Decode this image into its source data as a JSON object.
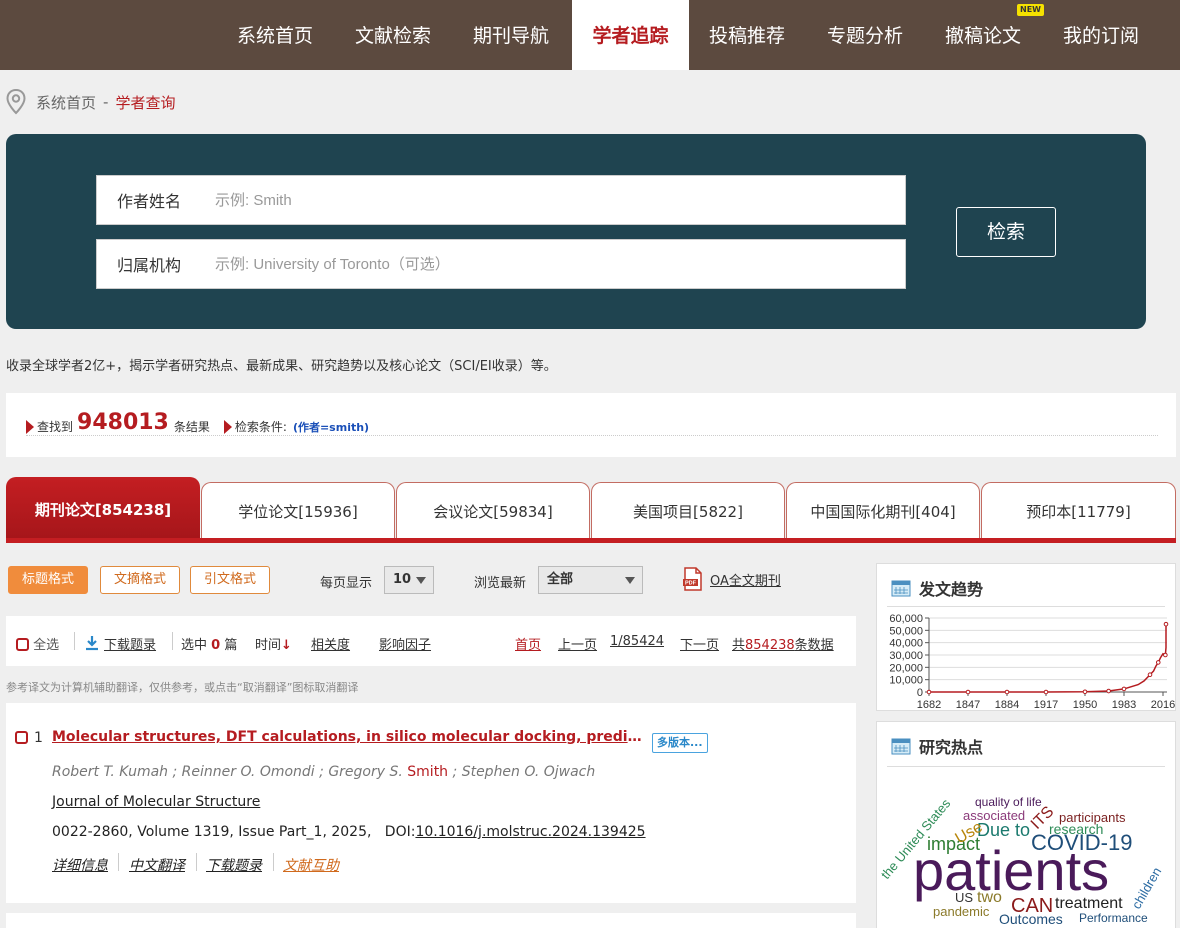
{
  "nav": [
    {
      "label": "系统首页",
      "active": false
    },
    {
      "label": "文献检索",
      "active": false
    },
    {
      "label": "期刊导航",
      "active": false
    },
    {
      "label": "学者追踪",
      "active": true
    },
    {
      "label": "投稿推荐",
      "active": false
    },
    {
      "label": "专题分析",
      "active": false
    },
    {
      "label": "撤稿论文",
      "active": false,
      "badge": "NEW"
    },
    {
      "label": "我的订阅",
      "active": false
    }
  ],
  "breadcrumb": {
    "home": "系统首页",
    "sep": "-",
    "current": "学者查询"
  },
  "search": {
    "author_label": "作者姓名",
    "author_placeholder": "示例: Smith",
    "org_label": "归属机构",
    "org_placeholder": "示例: University of Toronto（可选）",
    "button": "检索"
  },
  "description": "收录全球学者2亿+，揭示学者研究热点、最新成果、研究趋势以及核心论文（SCI/EI收录）等。",
  "summary": {
    "found_prefix": "查找到",
    "count": "948013",
    "found_suffix": "条结果",
    "cond_label": "检索条件:",
    "cond_value": "(作者=smith)"
  },
  "tabs": [
    {
      "label": "期刊论文[854238]",
      "active": true
    },
    {
      "label": "学位论文[15936]"
    },
    {
      "label": "会议论文[59834]"
    },
    {
      "label": "美国项目[5822]"
    },
    {
      "label": "中国国际化期刊[404]"
    },
    {
      "label": "预印本[11779]"
    }
  ],
  "formats": [
    "标题格式",
    "文摘格式",
    "引文格式"
  ],
  "perpage": {
    "label": "每页显示",
    "value": "10"
  },
  "browse": {
    "label": "浏览最新",
    "value": "全部"
  },
  "oa_label": "OA全文期刊",
  "toolbar": {
    "select_all": "全选",
    "download": "下载题录",
    "selected_prefix": "选中",
    "selected_count": "0",
    "selected_suffix": "篇",
    "sort_time": "时间",
    "sort_relevance": "相关度",
    "sort_impact": "影响因子",
    "first": "首页",
    "prev": "上一页",
    "page": "1/85424",
    "next": "下一页",
    "total_prefix": "共",
    "total_count": "854238",
    "total_suffix": "条数据"
  },
  "note": "参考译文为计算机辅助翻译，仅供参考，或点击“取消翻译”图标取消翻译",
  "record": {
    "index": "1",
    "title": "Molecular structures, DFT calculations, in silico molecular docking, predicted pharmacokinetics",
    "versions": "多版本...",
    "authors": [
      {
        "name": "Robert T. Kumah",
        "highlight": false
      },
      {
        "name": "Reinner O. Omondi",
        "highlight": false
      },
      {
        "name": "Gregory S.",
        "suffix": "Smith",
        "highlight": true
      },
      {
        "name": "Stephen O. Ojwach",
        "highlight": false
      }
    ],
    "author_sep": " ; ",
    "journal": "Journal of Molecular Structure",
    "meta": "0022-2860, Volume 1319, Issue Part_1, 2025,   DOI:",
    "doi": "10.1016/j.molstruc.2024.139425",
    "actions": [
      "详细信息",
      "中文翻译",
      "下载题录",
      "文献互助"
    ]
  },
  "sidebar": {
    "trend_title": "发文趋势",
    "hot_title": "研究热点"
  },
  "chart_data": {
    "type": "line",
    "x_ticks": [
      "1682",
      "1847",
      "1884",
      "1917",
      "1950",
      "1983",
      "2016"
    ],
    "y_ticks": [
      "60,000",
      "50,000",
      "40,000",
      "30,000",
      "20,000",
      "10,000",
      "0"
    ],
    "ylim": [
      0,
      60000
    ],
    "x": [
      1682,
      1847,
      1884,
      1917,
      1950,
      1970,
      1983,
      1995,
      2000,
      2005,
      2008,
      2010,
      2012,
      2014,
      2016,
      2018,
      2020,
      2022,
      2023,
      2024
    ],
    "y": [
      0,
      0,
      0,
      0,
      200,
      800,
      2500,
      6000,
      9000,
      14000,
      17000,
      21000,
      24000,
      28000,
      31000,
      30000,
      36000,
      42000,
      55000,
      40000
    ],
    "line_color": "#b51c20"
  },
  "wordcloud": [
    {
      "text": "patients",
      "color": "#4a1a5a"
    },
    {
      "text": "COVID-19",
      "color": "#1f4e79"
    },
    {
      "text": "impact",
      "color": "#2e7d32"
    },
    {
      "text": "Due to",
      "color": "#1b7a6e"
    },
    {
      "text": "ITS",
      "color": "#8b1a1a"
    },
    {
      "text": "CAN",
      "color": "#8b1a1a"
    },
    {
      "text": "treatment",
      "color": "#222"
    },
    {
      "text": "research",
      "color": "#2e8b57"
    },
    {
      "text": "participants",
      "color": "#7a1f1f"
    },
    {
      "text": "quality of life",
      "color": "#4a1a5a"
    },
    {
      "text": "associated",
      "color": "#8b3a7a"
    },
    {
      "text": "Use",
      "color": "#b8860b"
    },
    {
      "text": "the United States",
      "color": "#2e8b57"
    },
    {
      "text": "children",
      "color": "#2e6da4"
    },
    {
      "text": "two",
      "color": "#8b7a2a"
    },
    {
      "text": "US",
      "color": "#333"
    },
    {
      "text": "pandemic",
      "color": "#8b7a2a"
    },
    {
      "text": "Outcomes",
      "color": "#1f4e79"
    },
    {
      "text": "Performance",
      "color": "#1f4e79"
    }
  ]
}
